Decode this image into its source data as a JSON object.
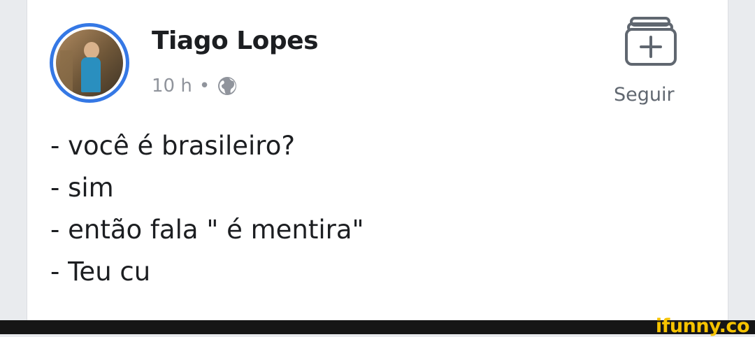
{
  "post": {
    "author_name": "Tiago Lopes",
    "time": "10 h",
    "separator": "•",
    "privacy_icon": "globe-icon",
    "follow_icon": "follow-add-icon",
    "follow_label": "Seguir",
    "lines": [
      "- você é brasileiro?",
      "- sim",
      "- então fala \" é mentira\"",
      "- Teu cu"
    ]
  },
  "watermark": "ifunny.co",
  "colors": {
    "avatar_ring": "#3578e5",
    "meta_text": "#90949c",
    "watermark": "#f6c300"
  }
}
